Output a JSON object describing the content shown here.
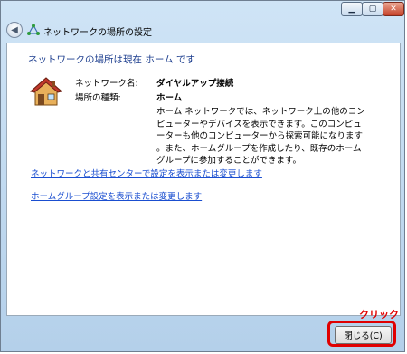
{
  "window": {
    "title": "ネットワークの場所の設定",
    "controls": {
      "minimize": "▁",
      "maximize": "▢",
      "close": "✕"
    }
  },
  "content": {
    "heading": "ネットワークの場所は現在 ホーム です",
    "network_name_label": "ネットワーク名:",
    "network_name_value": "ダイヤルアップ接続",
    "location_type_label": "場所の種類:",
    "location_type_value": "ホーム",
    "description_lines": [
      "ホーム ネットワークでは、ネットワーク上の他のコン",
      "ピューターやデバイスを表示できます。このコンピュ",
      "ーターも他のコンピューターから探索可能になります",
      "。また、ホームグループを作成したり、既存のホーム",
      "グループに参加することができます。"
    ],
    "link_sharing_center": "ネットワークと共有センターで設定を表示または変更します",
    "link_homegroup": "ホームグループ設定を表示または変更します"
  },
  "footer": {
    "close_button": "閉じる(C)"
  },
  "annotation": {
    "click_label": "クリック",
    "highlight_color": "#e00000"
  }
}
